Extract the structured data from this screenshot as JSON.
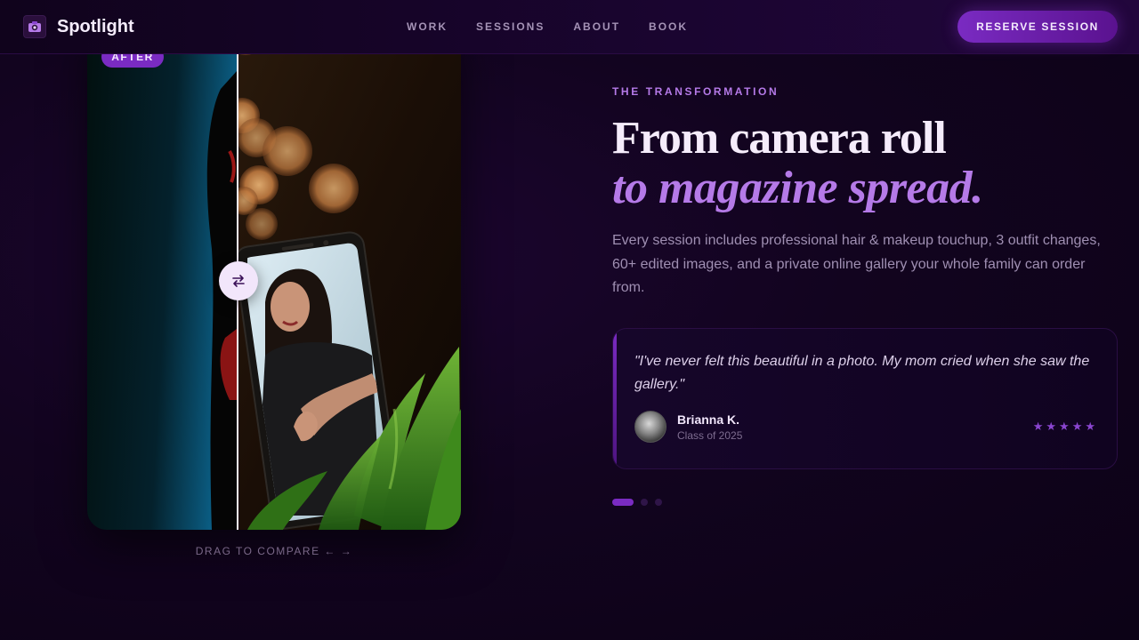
{
  "nav": {
    "brand": "Spotlight",
    "links": [
      "WORK",
      "SESSIONS",
      "ABOUT",
      "BOOK"
    ],
    "cta": "RESERVE SESSION"
  },
  "compare": {
    "badge": "AFTER",
    "hint": "DRAG TO COMPARE ← →",
    "handle_icon": "swap-arrows-icon"
  },
  "hero": {
    "eyebrow": "THE TRANSFORMATION",
    "headline_main": "From camera roll",
    "headline_accent": "to magazine spread.",
    "lede": "Every session includes professional hair & makeup touchup, 3 outfit changes, 60+ edited images, and a private online gallery your whole family can order from."
  },
  "testimonial": {
    "quote": "\"I've never felt this beautiful in a photo. My mom cried when she saw the gallery.\"",
    "author": "Brianna K.",
    "meta": "Class of 2025",
    "rating": 5
  },
  "carousel": {
    "count": 3,
    "active": 0
  },
  "colors": {
    "accent": "#7a2bc2",
    "accent_light": "#b57ae8",
    "bg": "#12041f"
  }
}
